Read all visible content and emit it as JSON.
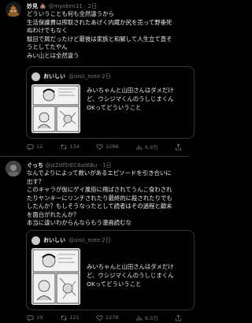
{
  "tweet1": {
    "name": "妙見",
    "handle": "@myoken11",
    "time": "2日",
    "lines": [
      "どういうことも何も全然違うから",
      "生活保護費は搾取されたあげく内蔵か尻を売って野垂死",
      "ぬわけでもなく",
      "駄目で屑だったけど最後は家族と和解して人生立て直そ",
      "うとしてたやん",
      "みい山とは全然違う"
    ],
    "quote": {
      "name": "おいしい",
      "handle": "@oisii_note",
      "time": "2日",
      "lines": [
        "みいちゃんと山田さんはダメだけ",
        "ど、ウシジマくんのうしじまくん",
        "OKってどういうこと"
      ]
    },
    "actions": {
      "replies": "12",
      "retweets": "134",
      "likes": "2286",
      "views": "6.9万"
    }
  },
  "tweet2": {
    "name": "ぐっち",
    "handle": "@jzZdf5rEC6at6Bu",
    "time": "1日",
    "lines": [
      "なんでよりによって救いがあるエピソードを引き合いに",
      "出す？",
      "このキャラが仮にゲイ風俗に飛ばされてうんこ食わされ",
      "たりヤンキーにリンチされたり最終的に殺されたりでも",
      "したんか？もしそうなったとして読者はその過程と顛末",
      "を面白がれたんか？",
      "本当に違いわからんならもう漫画読むな"
    ],
    "quote": {
      "name": "おいしい",
      "handle": "@oisii_note",
      "time": "2日",
      "lines": [
        "みいちゃんと山田さんはダメだけ",
        "ど、ウシジマくんのうしじまくん",
        "OKってどういうこと"
      ]
    },
    "actions": {
      "replies": "19",
      "retweets": "121",
      "likes": "2278",
      "views": "8.3万"
    }
  },
  "colors": {
    "background": "#000000",
    "text": "#e7e9ea",
    "muted": "#71767b",
    "border": "#333639"
  }
}
